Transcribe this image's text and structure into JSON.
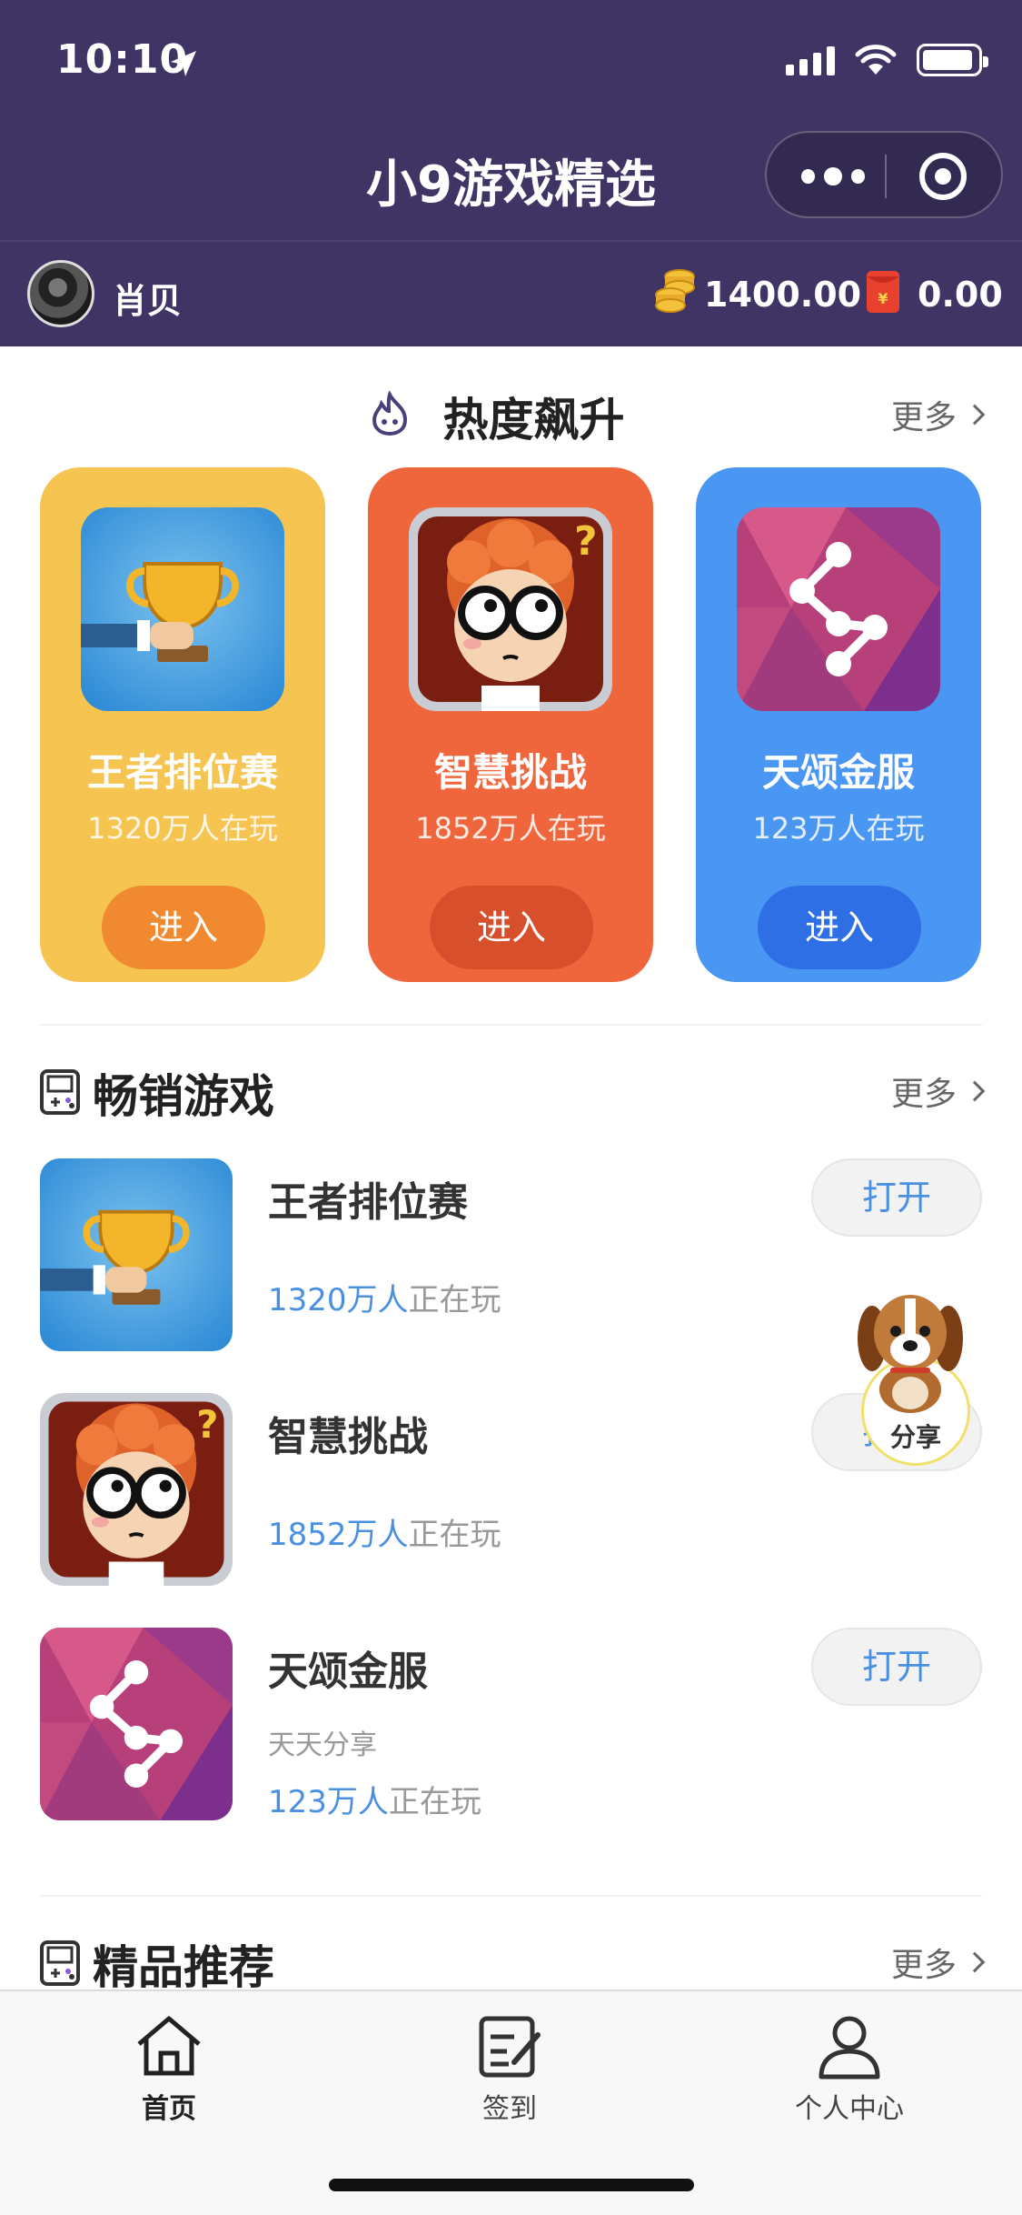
{
  "status_bar": {
    "time": "10:10"
  },
  "nav": {
    "title": "小9游戏精选"
  },
  "user": {
    "name": "肖贝",
    "coins": "1400.00",
    "red_packet": "0.00"
  },
  "hot_section": {
    "title": "热度飙升",
    "more_label": "更多",
    "cards": [
      {
        "name": "王者排位赛",
        "players": "1320万人在玩",
        "enter_label": "进入",
        "bg_color": "#f6c451",
        "btn_color": "#f0892f",
        "icon": "trophy-icon"
      },
      {
        "name": "智慧挑战",
        "players": "1852万人在玩",
        "enter_label": "进入",
        "bg_color": "#ef663c",
        "btn_color": "#d7502b",
        "icon": "cartoon-boy-icon"
      },
      {
        "name": "天颂金服",
        "players": "123万人在玩",
        "enter_label": "进入",
        "bg_color": "#4a96f3",
        "btn_color": "#2f6fe6",
        "icon": "share-nodes-icon"
      }
    ]
  },
  "bestseller_section": {
    "title": "畅销游戏",
    "more_label": "更多",
    "items": [
      {
        "name": "王者排位赛",
        "subtitle": "",
        "players_count": "1320万人",
        "players_suffix": "正在玩",
        "open_label": "打开",
        "icon": "trophy-icon"
      },
      {
        "name": "智慧挑战",
        "subtitle": "",
        "players_count": "1852万人",
        "players_suffix": "正在玩",
        "open_label": "打开",
        "icon": "cartoon-boy-icon"
      },
      {
        "name": "天颂金服",
        "subtitle": "天天分享",
        "players_count": "123万人",
        "players_suffix": "正在玩",
        "open_label": "打开",
        "icon": "share-nodes-icon"
      }
    ]
  },
  "premium_section": {
    "title": "精品推荐",
    "more_label": "更多"
  },
  "floating_share": {
    "label": "分享"
  },
  "tabbar": {
    "tabs": [
      {
        "label": "首页",
        "active": true
      },
      {
        "label": "签到",
        "active": false
      },
      {
        "label": "个人中心",
        "active": false
      }
    ]
  },
  "colors": {
    "header_bg": "#3f3464",
    "accent_blue": "#4a90e2"
  }
}
